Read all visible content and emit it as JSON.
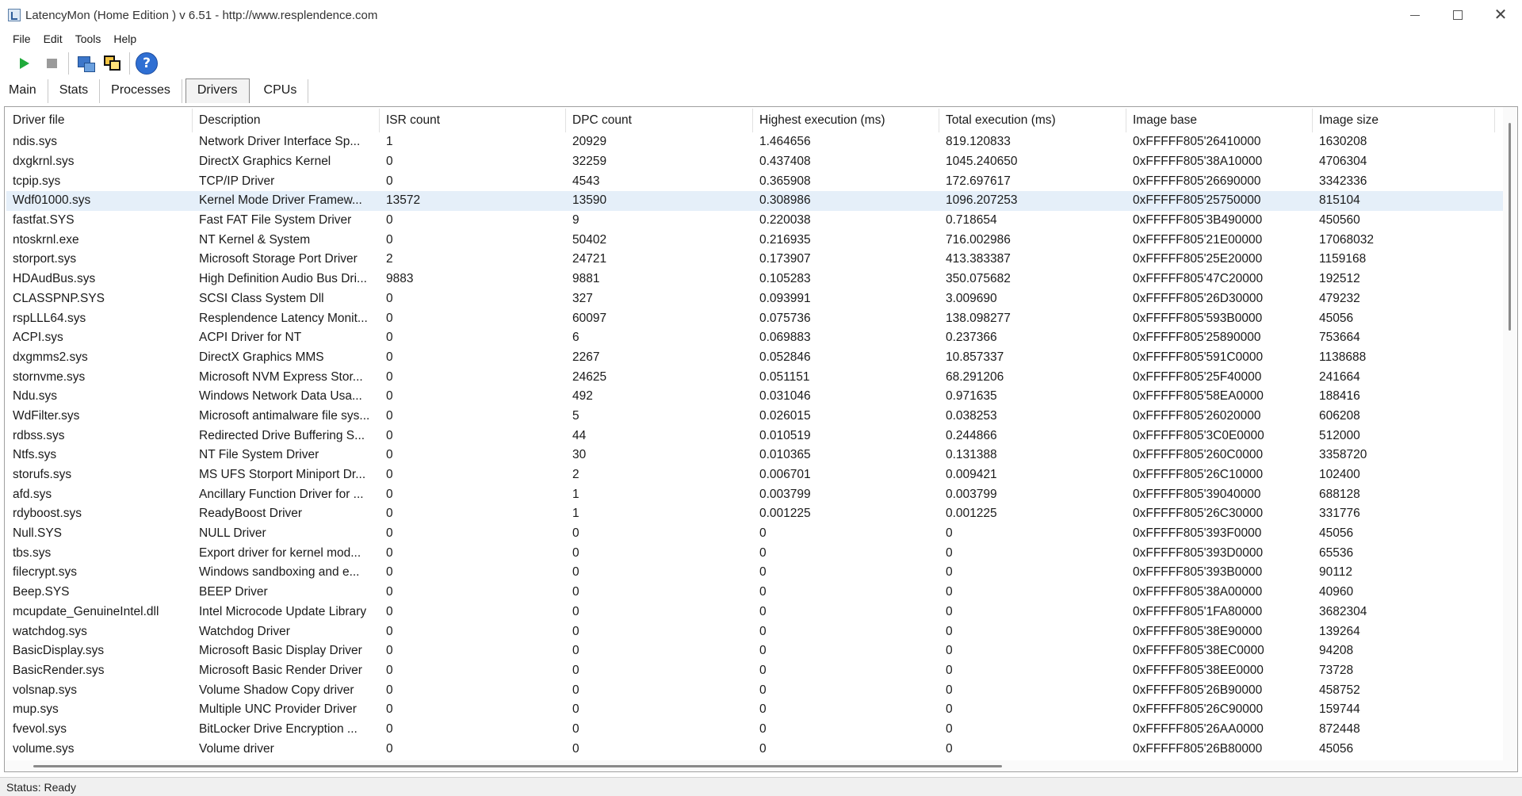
{
  "window": {
    "title": "LatencyMon  (Home Edition )  v 6.51 - http://www.resplendence.com"
  },
  "menu": [
    "File",
    "Edit",
    "Tools",
    "Help"
  ],
  "toolbar": {
    "icons": [
      "play-icon",
      "stop-icon",
      "tools-icon",
      "cpu-windows-icon",
      "help-icon"
    ],
    "help_glyph": "?"
  },
  "tabs": [
    {
      "label": "Main",
      "active": false
    },
    {
      "label": "Stats",
      "active": false
    },
    {
      "label": "Processes",
      "active": false
    },
    {
      "label": "Drivers",
      "active": true
    },
    {
      "label": "CPUs",
      "active": false
    }
  ],
  "table": {
    "columns": [
      "Driver file",
      "Description",
      "ISR count",
      "DPC count",
      "Highest execution (ms)",
      "Total execution (ms)",
      "Image base",
      "Image size"
    ],
    "selected_row": 3,
    "rows": [
      [
        "ndis.sys",
        "Network Driver Interface Sp...",
        "1",
        "20929",
        "1.464656",
        "819.120833",
        "0xFFFFF805'26410000",
        "1630208"
      ],
      [
        "dxgkrnl.sys",
        "DirectX Graphics Kernel",
        "0",
        "32259",
        "0.437408",
        "1045.240650",
        "0xFFFFF805'38A10000",
        "4706304"
      ],
      [
        "tcpip.sys",
        "TCP/IP Driver",
        "0",
        "4543",
        "0.365908",
        "172.697617",
        "0xFFFFF805'26690000",
        "3342336"
      ],
      [
        "Wdf01000.sys",
        "Kernel Mode Driver Framew...",
        "13572",
        "13590",
        "0.308986",
        "1096.207253",
        "0xFFFFF805'25750000",
        "815104"
      ],
      [
        "fastfat.SYS",
        "Fast FAT File System Driver",
        "0",
        "9",
        "0.220038",
        "0.718654",
        "0xFFFFF805'3B490000",
        "450560"
      ],
      [
        "ntoskrnl.exe",
        "NT Kernel & System",
        "0",
        "50402",
        "0.216935",
        "716.002986",
        "0xFFFFF805'21E00000",
        "17068032"
      ],
      [
        "storport.sys",
        "Microsoft Storage Port Driver",
        "2",
        "24721",
        "0.173907",
        "413.383387",
        "0xFFFFF805'25E20000",
        "1159168"
      ],
      [
        "HDAudBus.sys",
        "High Definition Audio Bus Dri...",
        "9883",
        "9881",
        "0.105283",
        "350.075682",
        "0xFFFFF805'47C20000",
        "192512"
      ],
      [
        "CLASSPNP.SYS",
        "SCSI Class System Dll",
        "0",
        "327",
        "0.093991",
        "3.009690",
        "0xFFFFF805'26D30000",
        "479232"
      ],
      [
        "rspLLL64.sys",
        "Resplendence Latency Monit...",
        "0",
        "60097",
        "0.075736",
        "138.098277",
        "0xFFFFF805'593B0000",
        "45056"
      ],
      [
        "ACPI.sys",
        "ACPI Driver for NT",
        "0",
        "6",
        "0.069883",
        "0.237366",
        "0xFFFFF805'25890000",
        "753664"
      ],
      [
        "dxgmms2.sys",
        "DirectX Graphics MMS",
        "0",
        "2267",
        "0.052846",
        "10.857337",
        "0xFFFFF805'591C0000",
        "1138688"
      ],
      [
        "stornvme.sys",
        "Microsoft NVM Express Stor...",
        "0",
        "24625",
        "0.051151",
        "68.291206",
        "0xFFFFF805'25F40000",
        "241664"
      ],
      [
        "Ndu.sys",
        "Windows Network Data Usa...",
        "0",
        "492",
        "0.031046",
        "0.971635",
        "0xFFFFF805'58EA0000",
        "188416"
      ],
      [
        "WdFilter.sys",
        "Microsoft antimalware file sys...",
        "0",
        "5",
        "0.026015",
        "0.038253",
        "0xFFFFF805'26020000",
        "606208"
      ],
      [
        "rdbss.sys",
        "Redirected Drive Buffering S...",
        "0",
        "44",
        "0.010519",
        "0.244866",
        "0xFFFFF805'3C0E0000",
        "512000"
      ],
      [
        "Ntfs.sys",
        "NT File System Driver",
        "0",
        "30",
        "0.010365",
        "0.131388",
        "0xFFFFF805'260C0000",
        "3358720"
      ],
      [
        "storufs.sys",
        "MS UFS Storport Miniport Dr...",
        "0",
        "2",
        "0.006701",
        "0.009421",
        "0xFFFFF805'26C10000",
        "102400"
      ],
      [
        "afd.sys",
        "Ancillary Function Driver for ...",
        "0",
        "1",
        "0.003799",
        "0.003799",
        "0xFFFFF805'39040000",
        "688128"
      ],
      [
        "rdyboost.sys",
        "ReadyBoost Driver",
        "0",
        "1",
        "0.001225",
        "0.001225",
        "0xFFFFF805'26C30000",
        "331776"
      ],
      [
        "Null.SYS",
        "NULL Driver",
        "0",
        "0",
        "0",
        "0",
        "0xFFFFF805'393F0000",
        "45056"
      ],
      [
        "tbs.sys",
        "Export driver for kernel mod...",
        "0",
        "0",
        "0",
        "0",
        "0xFFFFF805'393D0000",
        "65536"
      ],
      [
        "filecrypt.sys",
        "Windows sandboxing and e...",
        "0",
        "0",
        "0",
        "0",
        "0xFFFFF805'393B0000",
        "90112"
      ],
      [
        "Beep.SYS",
        "BEEP Driver",
        "0",
        "0",
        "0",
        "0",
        "0xFFFFF805'38A00000",
        "40960"
      ],
      [
        "mcupdate_GenuineIntel.dll",
        "Intel Microcode Update Library",
        "0",
        "0",
        "0",
        "0",
        "0xFFFFF805'1FA80000",
        "3682304"
      ],
      [
        "watchdog.sys",
        "Watchdog Driver",
        "0",
        "0",
        "0",
        "0",
        "0xFFFFF805'38E90000",
        "139264"
      ],
      [
        "BasicDisplay.sys",
        "Microsoft Basic Display Driver",
        "0",
        "0",
        "0",
        "0",
        "0xFFFFF805'38EC0000",
        "94208"
      ],
      [
        "BasicRender.sys",
        "Microsoft Basic Render Driver",
        "0",
        "0",
        "0",
        "0",
        "0xFFFFF805'38EE0000",
        "73728"
      ],
      [
        "volsnap.sys",
        "Volume Shadow Copy driver",
        "0",
        "0",
        "0",
        "0",
        "0xFFFFF805'26B90000",
        "458752"
      ],
      [
        "mup.sys",
        "Multiple UNC Provider Driver",
        "0",
        "0",
        "0",
        "0",
        "0xFFFFF805'26C90000",
        "159744"
      ],
      [
        "fvevol.sys",
        "BitLocker Drive Encryption ...",
        "0",
        "0",
        "0",
        "0",
        "0xFFFFF805'26AA0000",
        "872448"
      ],
      [
        "volume.sys",
        "Volume driver",
        "0",
        "0",
        "0",
        "0",
        "0xFFFFF805'26B80000",
        "45056"
      ]
    ]
  },
  "status": "Status: Ready"
}
